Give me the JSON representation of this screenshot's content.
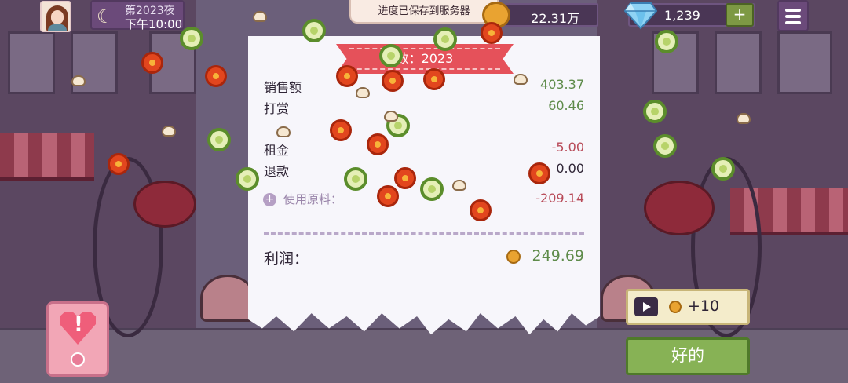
{
  "hud": {
    "night_label": "第2023夜",
    "time_label": "下午10:00",
    "save_toast": "进度已保存到服务器",
    "coins": "22.31万",
    "gems": "1,239",
    "add_gems_label": "+"
  },
  "receipt": {
    "title": "数：2023",
    "rows": [
      {
        "label": "销售额",
        "value": "403.37"
      },
      {
        "label": "打赏",
        "value": "60.46"
      },
      {
        "label": "租金",
        "value": "-5.00"
      },
      {
        "label": "退款",
        "value": "0.00"
      }
    ],
    "materials": {
      "label": "使用原料：",
      "value": "-209.14",
      "toggle": "+"
    },
    "profit": {
      "label": "利润：",
      "value": "249.69"
    }
  },
  "actions": {
    "ad_reward": "+10",
    "ok_label": "好的"
  },
  "alert_card": {
    "symbol": "!"
  },
  "colors": {
    "positive": "#5e8b4a",
    "negative": "#b84a58",
    "ribbon": "#e5515a",
    "ok_button": "#87b255"
  },
  "icons": [
    "moon-icon",
    "coin-icon",
    "diamond-icon",
    "menu-icon",
    "play-video-icon",
    "heart-alert-icon"
  ]
}
